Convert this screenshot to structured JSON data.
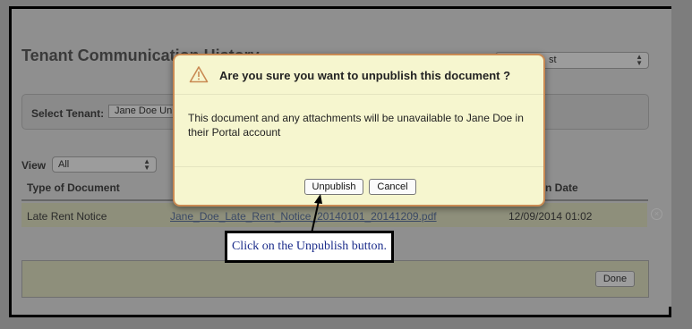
{
  "page": {
    "title": "Tenant Communication History",
    "top_select_partial": "st",
    "select_tenant_label": "Select Tenant:",
    "tenant_value": "Jane Doe Un",
    "view_label": "View",
    "view_value": "All",
    "columns": {
      "type": "Type of Document",
      "date_partial": "n Date"
    },
    "row": {
      "type": "Late Rent Notice",
      "file": "Jane_Doe_Late_Rent_Notice_20140101_20141209.pdf",
      "date": "12/09/2014 01:02"
    },
    "done_label": "Done"
  },
  "dialog": {
    "title": "Are you sure you want to unpublish this document ?",
    "message": "This document and any attachments will be unavailable to Jane Doe in their Portal account",
    "unpublish_label": "Unpublish",
    "cancel_label": "Cancel",
    "icon": "warning-icon",
    "accent": "#c98a53"
  },
  "callout": {
    "text": "Click on the Unpublish button."
  }
}
